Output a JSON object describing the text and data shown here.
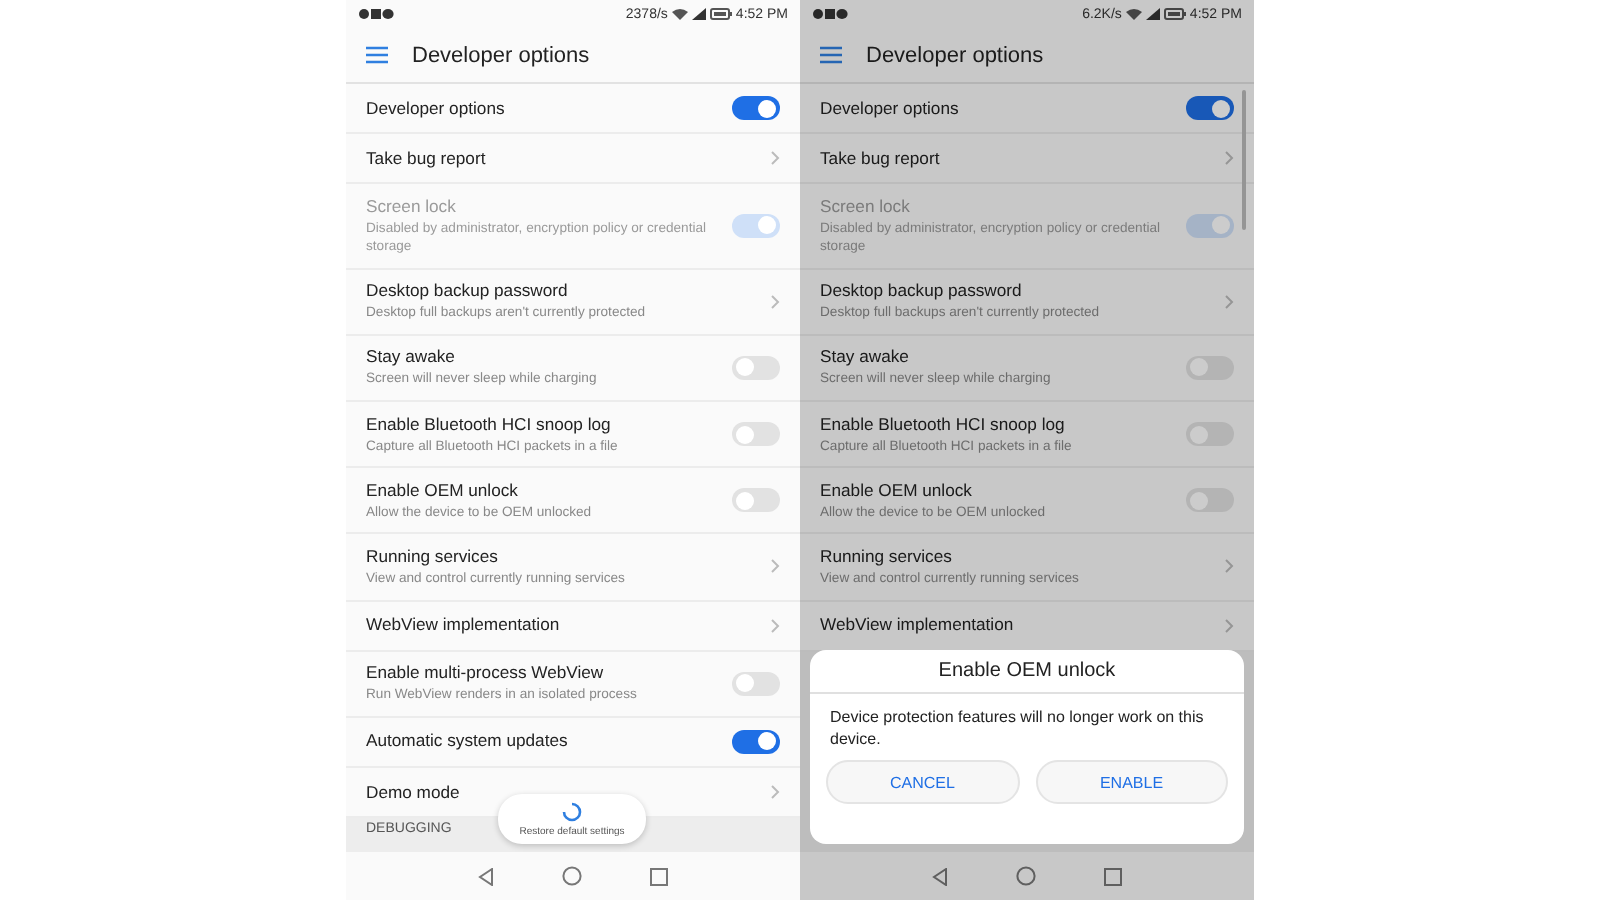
{
  "screens": [
    {
      "status_bar": {
        "speed": "2378/s",
        "time": "4:52 PM"
      },
      "toolbar": {
        "title": "Developer options"
      },
      "settings": [
        {
          "kind": "toggle",
          "title": "Developer options",
          "on": true,
          "disabled": false
        },
        {
          "kind": "link",
          "title": "Take bug report",
          "disabled": false
        },
        {
          "kind": "toggle",
          "title": "Screen lock",
          "subtitle": "Disabled by administrator, encryption policy or credential storage",
          "on": true,
          "disabled": true
        },
        {
          "kind": "link",
          "title": "Desktop backup password",
          "subtitle": "Desktop full backups aren't currently protected",
          "disabled": false
        },
        {
          "kind": "toggle",
          "title": "Stay awake",
          "subtitle": "Screen will never sleep while charging",
          "on": false,
          "disabled": false
        },
        {
          "kind": "toggle",
          "title": "Enable Bluetooth HCI snoop log",
          "subtitle": "Capture all Bluetooth HCI packets in a file",
          "on": false,
          "disabled": false
        },
        {
          "kind": "toggle",
          "title": "Enable OEM unlock",
          "subtitle": "Allow the device to be OEM unlocked",
          "on": false,
          "disabled": false
        },
        {
          "kind": "link",
          "title": "Running services",
          "subtitle": "View and control currently running services",
          "disabled": false
        },
        {
          "kind": "link",
          "title": "WebView implementation",
          "disabled": false
        },
        {
          "kind": "toggle",
          "title": "Enable multi-process WebView",
          "subtitle": "Run WebView renders in an isolated process",
          "on": false,
          "disabled": false
        },
        {
          "kind": "toggle",
          "title": "Automatic system updates",
          "on": true,
          "disabled": false
        },
        {
          "kind": "link",
          "title": "Demo mode",
          "disabled": false
        }
      ],
      "section_header": "DEBUGGING",
      "toast": {
        "text": "Restore default settings"
      }
    },
    {
      "status_bar": {
        "speed": "6.2K/s",
        "time": "4:52 PM"
      },
      "toolbar": {
        "title": "Developer options"
      },
      "settings": [
        {
          "kind": "toggle",
          "title": "Developer options",
          "on": true,
          "disabled": false
        },
        {
          "kind": "link",
          "title": "Take bug report",
          "disabled": false
        },
        {
          "kind": "toggle",
          "title": "Screen lock",
          "subtitle": "Disabled by administrator, encryption policy or credential storage",
          "on": true,
          "disabled": true
        },
        {
          "kind": "link",
          "title": "Desktop backup password",
          "subtitle": "Desktop full backups aren't currently protected",
          "disabled": false
        },
        {
          "kind": "toggle",
          "title": "Stay awake",
          "subtitle": "Screen will never sleep while charging",
          "on": false,
          "disabled": false
        },
        {
          "kind": "toggle",
          "title": "Enable Bluetooth HCI snoop log",
          "subtitle": "Capture all Bluetooth HCI packets in a file",
          "on": false,
          "disabled": false
        },
        {
          "kind": "toggle",
          "title": "Enable OEM unlock",
          "subtitle": "Allow the device to be OEM unlocked",
          "on": false,
          "disabled": false
        },
        {
          "kind": "link",
          "title": "Running services",
          "subtitle": "View and control currently running services",
          "disabled": false
        },
        {
          "kind": "link",
          "title": "WebView implementation",
          "disabled": false
        }
      ],
      "dialog": {
        "title": "Enable OEM unlock",
        "message": "Device protection features will no longer work on this device.",
        "buttons": [
          "CANCEL",
          "ENABLE"
        ]
      }
    }
  ]
}
